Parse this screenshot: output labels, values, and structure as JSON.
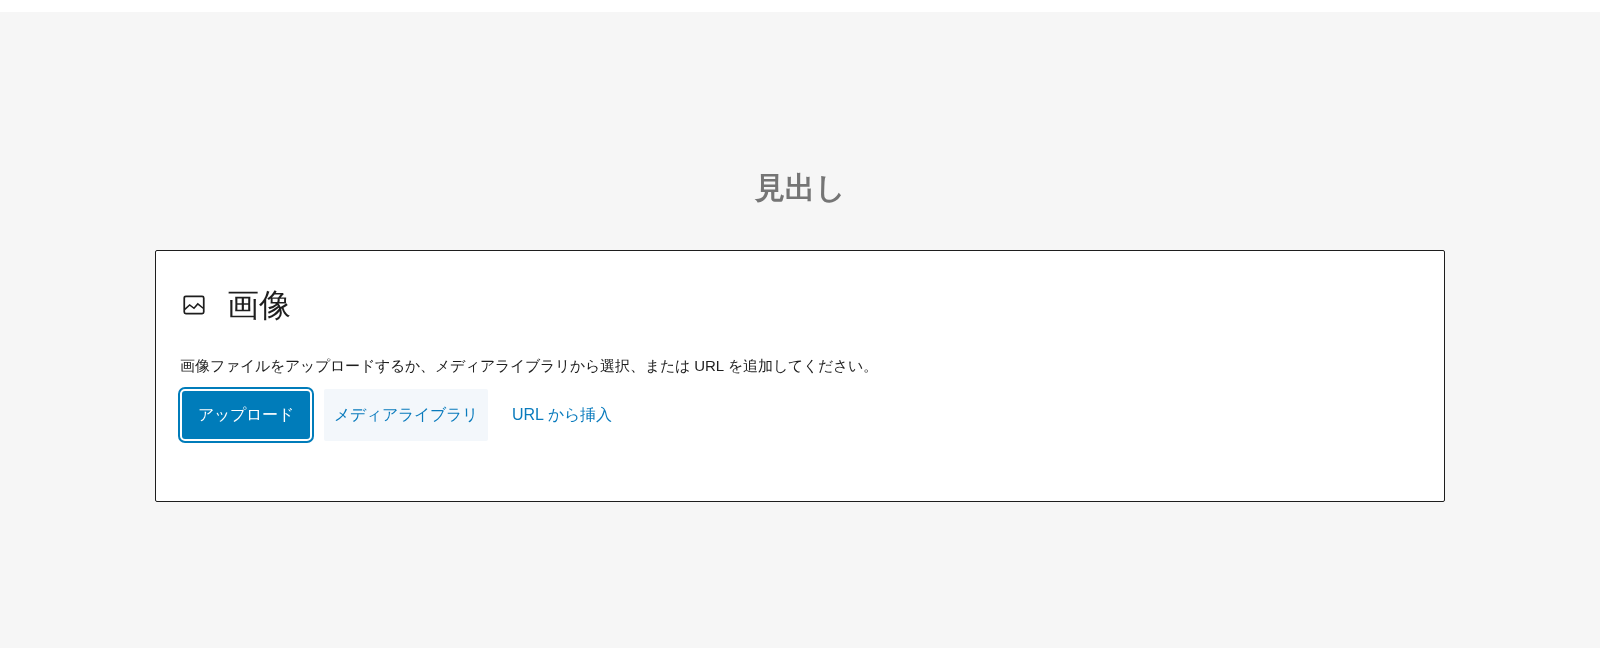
{
  "heading": "見出し",
  "image_block": {
    "title": "画像",
    "instructions": "画像ファイルをアップロードするか、メディアライブラリから選択、または URL を追加してください。",
    "buttons": [
      {
        "label": "アップロード",
        "kind": "primary"
      },
      {
        "label": "メディアライブラリ",
        "kind": "secondary"
      },
      {
        "label": "URL から挿入",
        "kind": "link"
      }
    ]
  }
}
